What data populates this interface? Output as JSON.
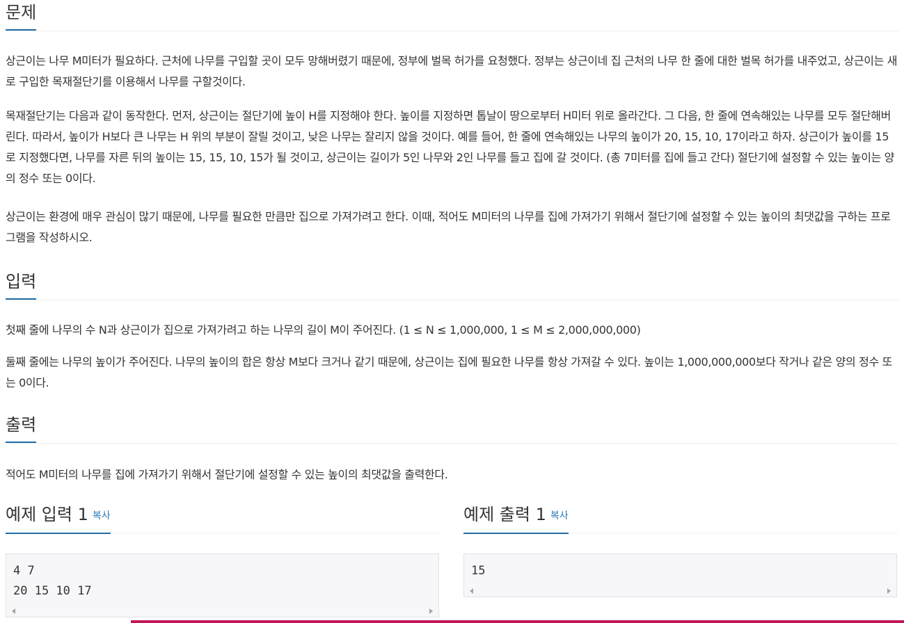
{
  "problem": {
    "heading": "문제",
    "paragraphs": [
      "상근이는 나무 M미터가 필요하다. 근처에 나무를 구입할 곳이 모두 망해버렸기 때문에, 정부에 벌목 허가를 요청했다. 정부는 상근이네 집 근처의 나무 한 줄에 대한 벌목 허가를 내주었고, 상근이는 새로 구입한 목재절단기를 이용해서 나무를 구할것이다.",
      "목재절단기는 다음과 같이 동작한다. 먼저, 상근이는 절단기에 높이 H를 지정해야 한다. 높이를 지정하면 톱날이 땅으로부터 H미터 위로 올라간다. 그 다음, 한 줄에 연속해있는 나무를 모두 절단해버린다. 따라서, 높이가 H보다 큰 나무는 H 위의 부분이 잘릴 것이고, 낮은 나무는 잘리지 않을 것이다. 예를 들어, 한 줄에 연속해있는 나무의 높이가 20, 15, 10, 17이라고 하자. 상근이가 높이를 15로 지정했다면, 나무를 자른 뒤의 높이는 15, 15, 10, 15가 될 것이고, 상근이는 길이가 5인 나무와 2인 나무를 들고 집에 갈 것이다. (총 7미터를 집에 들고 간다) 절단기에 설정할 수 있는 높이는 양의 정수 또는 0이다.",
      "상근이는 환경에 매우 관심이 많기 때문에, 나무를 필요한 만큼만 집으로 가져가려고 한다. 이때, 적어도 M미터의 나무를 집에 가져가기 위해서 절단기에 설정할 수 있는 높이의 최댓값을 구하는 프로그램을 작성하시오."
    ]
  },
  "input": {
    "heading": "입력",
    "paragraphs": [
      "첫째 줄에 나무의 수 N과 상근이가 집으로 가져가려고 하는 나무의 길이 M이 주어진다. (1 ≤ N ≤ 1,000,000, 1 ≤ M ≤ 2,000,000,000)",
      "둘째 줄에는 나무의 높이가 주어진다. 나무의 높이의 합은 항상 M보다 크거나 같기 때문에, 상근이는 집에 필요한 나무를 항상 가져갈 수 있다. 높이는 1,000,000,000보다 작거나 같은 양의 정수 또는 0이다."
    ]
  },
  "output": {
    "heading": "출력",
    "paragraphs": [
      "적어도 M미터의 나무를 집에 가져가기 위해서 절단기에 설정할 수 있는 높이의 최댓값을 출력한다."
    ]
  },
  "samples": {
    "input": {
      "heading": "예제 입력 1",
      "copy_label": "복사",
      "content": "4 7\n20 15 10 17"
    },
    "output": {
      "heading": "예제 출력 1",
      "copy_label": "복사",
      "content": "15"
    }
  },
  "colors": {
    "heading_underline": "#1f6ba5",
    "copy_link": "#2f79b5",
    "code_background": "#f7f7f9",
    "bottom_strip": "#c2185b"
  },
  "icons": [
    "scroll-left-arrow-icon",
    "scroll-right-arrow-icon"
  ]
}
